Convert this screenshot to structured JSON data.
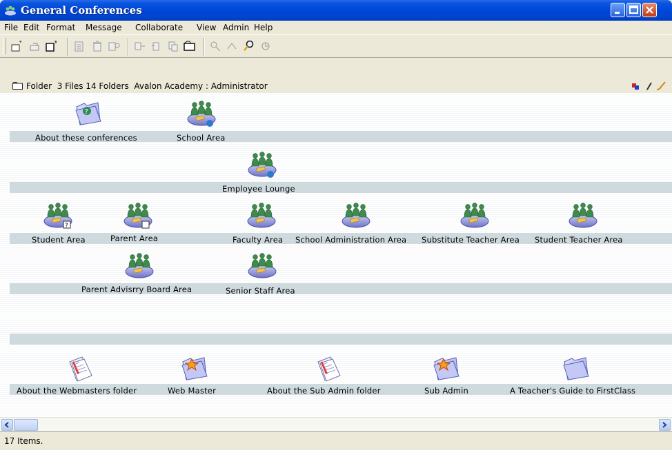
{
  "window": {
    "title": "General Conferences"
  },
  "menu": [
    "File",
    "Edit",
    "Format",
    "Message",
    "Collaborate",
    "View",
    "Admin",
    "Help"
  ],
  "toolbar": {
    "icons": [
      "new-icon",
      "reply-icon",
      "new-folder-icon",
      "print-icon",
      "delete-icon",
      "properties-icon",
      "forward-icon",
      "move-icon",
      "copy-icon",
      "open-folder-icon",
      "search-people-icon",
      "history-icon",
      "find-icon",
      "sync-icon"
    ]
  },
  "pathbar": {
    "text": "Folder  3 Files 14 Folders  Avalon Academy : Administrator"
  },
  "items": {
    "about_conferences": "About these conferences",
    "school_area": "School Area",
    "employee_lounge": "Employee Lounge",
    "student_area": "Student Area",
    "parent_area": "Parent Area",
    "faculty_area": "Faculty Area",
    "school_admin_area": "School Administration Area",
    "substitute_teacher_area": "Substitute Teacher Area",
    "student_teacher_area": "Student Teacher Area",
    "parent_advisory_board": "Parent Advisrry Board Area",
    "senior_staff_area": "Senior Staff Area",
    "about_webmasters": "About the Webmasters folder",
    "web_master": "Web Master",
    "about_sub_admin": "About the Sub Admin folder",
    "sub_admin": "Sub Admin",
    "teachers_guide": "A Teacher's Guide to FirstClass"
  },
  "status": {
    "text": "17 Items."
  }
}
